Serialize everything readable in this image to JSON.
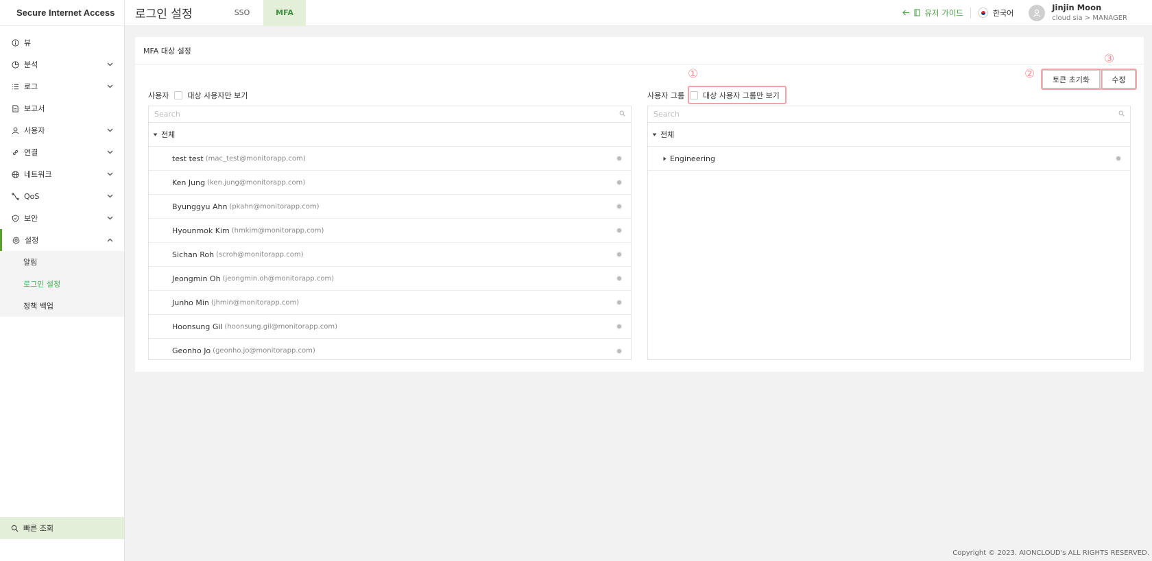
{
  "sidebar": {
    "brand": "Secure Internet Access",
    "items": [
      {
        "label": "뷰",
        "icon": "info-icon"
      },
      {
        "label": "분석",
        "icon": "pie-chart-icon"
      },
      {
        "label": "로그",
        "icon": "list-icon"
      },
      {
        "label": "보고서",
        "icon": "report-icon"
      },
      {
        "label": "사용자",
        "icon": "user-icon"
      },
      {
        "label": "연결",
        "icon": "link-icon"
      },
      {
        "label": "네트워크",
        "icon": "globe-icon"
      },
      {
        "label": "QoS",
        "icon": "qos-icon"
      },
      {
        "label": "보안",
        "icon": "shield-icon"
      },
      {
        "label": "설정",
        "icon": "gear-icon"
      }
    ],
    "sub_items": [
      {
        "label": "알림"
      },
      {
        "label": "로그인 설정"
      },
      {
        "label": "정책 백업"
      }
    ],
    "quick_search": "빠른 조회"
  },
  "header": {
    "title": "로그인 설정",
    "tabs": [
      {
        "label": "SSO"
      },
      {
        "label": "MFA"
      }
    ],
    "guide": "유저 가이드",
    "language": "한국어",
    "user_name": "Jinjin Moon",
    "user_role": "cloud sia > MANAGER"
  },
  "panel": {
    "title": "MFA 대상 설정",
    "reset_button": "토큰 초기화",
    "edit_button": "수정",
    "annotations": [
      "①",
      "②",
      "③"
    ],
    "users": {
      "label": "사용자",
      "filter": "대상 사용자만 보기",
      "search_placeholder": "Search",
      "root": "전체",
      "rows": [
        {
          "name": "test test",
          "email": "(mac_test@monitorapp.com)"
        },
        {
          "name": "Ken Jung",
          "email": "(ken.jung@monitorapp.com)"
        },
        {
          "name": "Byunggyu Ahn",
          "email": "(pkahn@monitorapp.com)"
        },
        {
          "name": "Hyounmok Kim",
          "email": "(hmkim@monitorapp.com)"
        },
        {
          "name": "Sichan Roh",
          "email": "(scroh@monitorapp.com)"
        },
        {
          "name": "Jeongmin Oh",
          "email": "(jeongmin.oh@monitorapp.com)"
        },
        {
          "name": "Junho Min",
          "email": "(jhmin@monitorapp.com)"
        },
        {
          "name": "Hoonsung Gil",
          "email": "(hoonsung.gil@monitorapp.com)"
        },
        {
          "name": "Geonho Jo",
          "email": "(geonho.jo@monitorapp.com)"
        }
      ]
    },
    "groups": {
      "label": "사용자 그룹",
      "filter": "대상 사용자 그룹만 보기",
      "search_placeholder": "Search",
      "root": "전체",
      "rows": [
        {
          "name": "Engineering"
        }
      ]
    }
  },
  "footer": {
    "copyright": "Copyright © 2023. AIONCLOUD's ALL RIGHTS RESERVED."
  },
  "colors": {
    "accent": "#4fa14a",
    "tab_active_bg": "#e4efda",
    "annotation": "#f2a2a8"
  }
}
